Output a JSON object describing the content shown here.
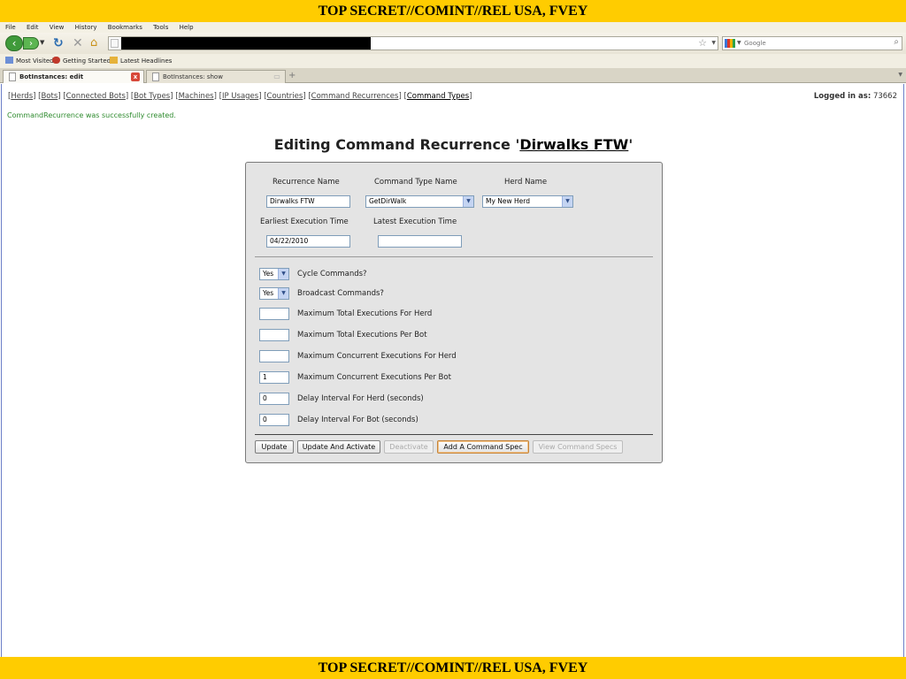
{
  "banner": {
    "top": "TOP SECRET//COMINT//REL USA, FVEY",
    "bottom": "TOP SECRET//COMINT//REL USA, FVEY"
  },
  "menu": [
    "File",
    "Edit",
    "View",
    "History",
    "Bookmarks",
    "Tools",
    "Help"
  ],
  "toolbar": {
    "search_placeholder": "Google"
  },
  "bookmarks": [
    "Most Visited",
    "Getting Started",
    "Latest Headlines"
  ],
  "tabs": [
    {
      "label": "BotInstances: edit"
    },
    {
      "label": "BotInstances: show"
    }
  ],
  "nav": {
    "links": [
      "Herds",
      "Bots",
      "Connected Bots",
      "Bot Types",
      "Machines",
      "IP Usages",
      "Countries",
      "Command Recurrences",
      "Command Types"
    ],
    "logged_in_label": "Logged in as:",
    "logged_in_user": "73662"
  },
  "notice": "CommandRecurrence was successfully created.",
  "title": {
    "prefix": "Editing Command Recurrence '",
    "name": "Dirwalks FTW",
    "suffix": "'"
  },
  "form": {
    "recurrence_name_label": "Recurrence Name",
    "recurrence_name_value": "Dirwalks FTW",
    "command_type_label": "Command Type Name",
    "command_type_value": "GetDirWalk",
    "herd_label": "Herd Name",
    "herd_value": "My New Herd",
    "earliest_label": "Earliest Execution Time",
    "earliest_value": "04/22/2010",
    "latest_label": "Latest Execution Time",
    "latest_value": "",
    "cycle_value": "Yes",
    "cycle_label": "Cycle Commands?",
    "broadcast_value": "Yes",
    "broadcast_label": "Broadcast Commands?",
    "fields": [
      {
        "label": "Maximum Total Executions For Herd",
        "value": ""
      },
      {
        "label": "Maximum Total Executions Per Bot",
        "value": ""
      },
      {
        "label": "Maximum Concurrent Executions For Herd",
        "value": ""
      },
      {
        "label": "Maximum Concurrent Executions Per Bot",
        "value": "1"
      },
      {
        "label": "Delay Interval For Herd (seconds)",
        "value": "0"
      },
      {
        "label": "Delay Interval For Bot (seconds)",
        "value": "0"
      }
    ]
  },
  "buttons": {
    "update": "Update",
    "update_activate": "Update And Activate",
    "deactivate": "Deactivate",
    "add_spec": "Add A Command Spec",
    "view_specs": "View Command Specs"
  }
}
